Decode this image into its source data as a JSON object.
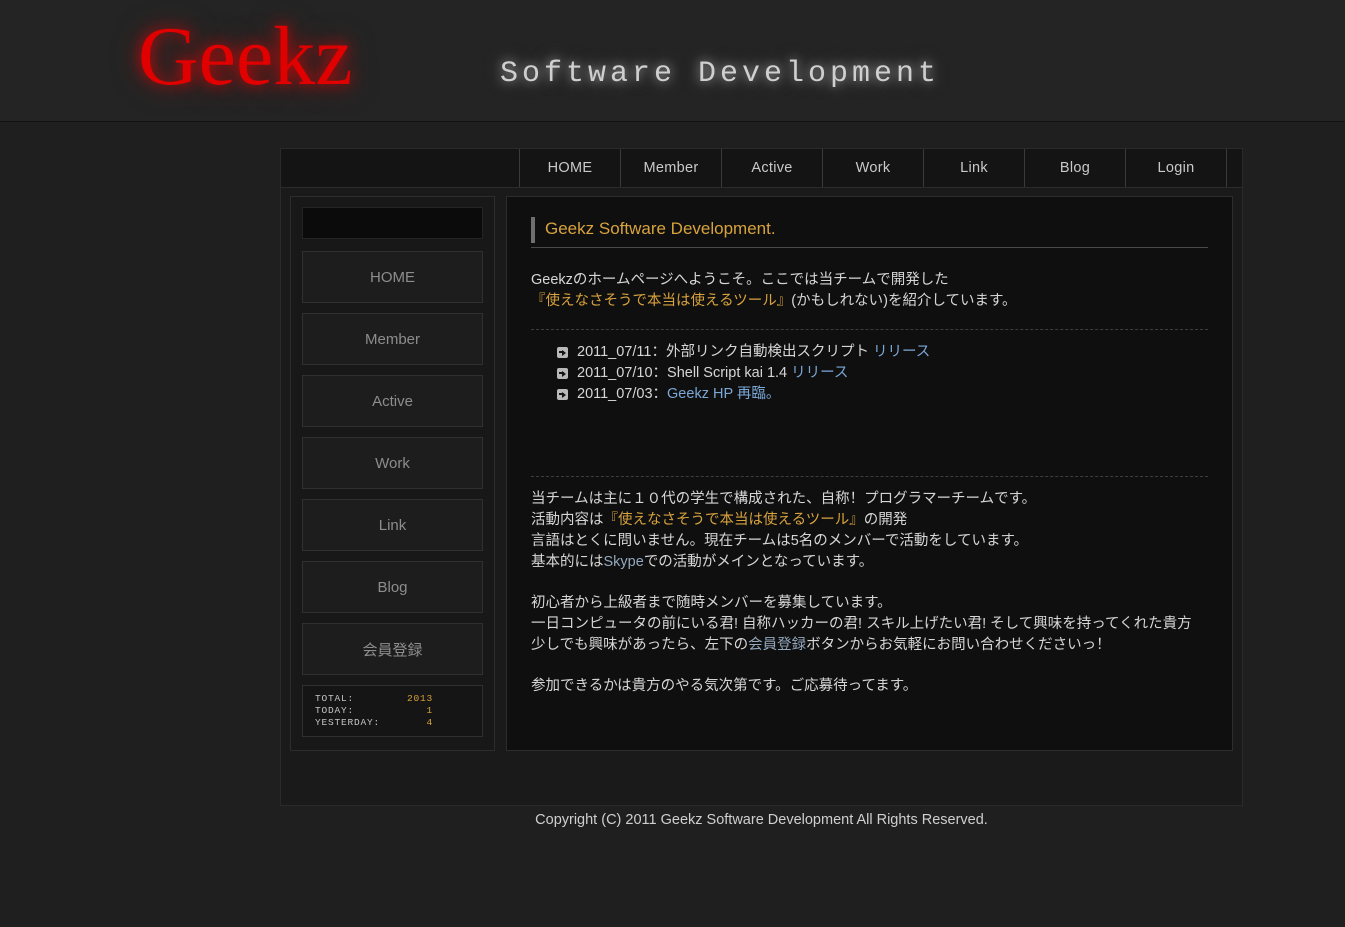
{
  "banner": {
    "logo": "Geekz",
    "tagline": "Software Development"
  },
  "topnav": {
    "items": [
      {
        "label": "HOME"
      },
      {
        "label": "Member"
      },
      {
        "label": "Active"
      },
      {
        "label": "Work"
      },
      {
        "label": "Link"
      },
      {
        "label": "Blog"
      },
      {
        "label": "Login"
      }
    ]
  },
  "sidebar": {
    "buttons": [
      {
        "label": "HOME"
      },
      {
        "label": "Member"
      },
      {
        "label": "Active"
      },
      {
        "label": "Work"
      },
      {
        "label": "Link"
      },
      {
        "label": "Blog"
      },
      {
        "label": "会員登録"
      }
    ],
    "counter": {
      "total_label": "TOTAL:",
      "total_value": "2013",
      "today_label": "TODAY:",
      "today_value": "1",
      "yesterday_label": "YESTERDAY:",
      "yesterday_value": "4"
    }
  },
  "content": {
    "section_title": "Geekz Software Development.",
    "intro_line1": "Geekzのホームページへようこそ。ここでは当チームで開発した",
    "intro_line2_hl": "『使えなさそうで本当は使えるツール』",
    "intro_line2_rest": "(かもしれない)を紹介しています。",
    "news": [
      {
        "date": "2011_07/11：",
        "text": "外部リンク自動検出スクリプト ",
        "link": "リリース"
      },
      {
        "date": "2011_07/10：",
        "text": "Shell Script kai 1.4 ",
        "link": "リリース"
      },
      {
        "date": "2011_07/03：",
        "text": "",
        "link": "Geekz HP 再臨。"
      }
    ],
    "about_line1": "当チームは主に１０代の学生で構成された、自称！プログラマーチームです。",
    "about_line2_pre": "活動内容は",
    "about_line2_hl": "『使えなさそうで本当は使えるツール』",
    "about_line2_post": "の開発",
    "about_line3": "言語はとくに問いません。現在チームは5名のメンバーで活動をしています。",
    "about_line4_pre": "基本的には",
    "about_line4_link": "Skype",
    "about_line4_post": "での活動がメインとなっています。",
    "recruit_line1": "初心者から上級者まで随時メンバーを募集しています。",
    "recruit_line2": "一日コンピュータの前にいる君! 自称ハッカーの君! スキル上げたい君! そして興味を持ってくれた貴方",
    "recruit_line3_pre": "少しでも興味があったら、左下の",
    "recruit_line3_link": "会員登録",
    "recruit_line3_post": "ボタンからお気軽にお問い合わせくださいっ！",
    "closing": "参加できるかは貴方のやる気次第です。ご応募待ってます。"
  },
  "footer": {
    "copyright": "Copyright (C) 2011 Geekz Software Development All Rights Reserved."
  },
  "colors": {
    "accent_orange": "#d8a33c",
    "logo_red": "#e00000",
    "link_blue": "#7ba7d7",
    "page_bg": "#1f1f1f"
  }
}
